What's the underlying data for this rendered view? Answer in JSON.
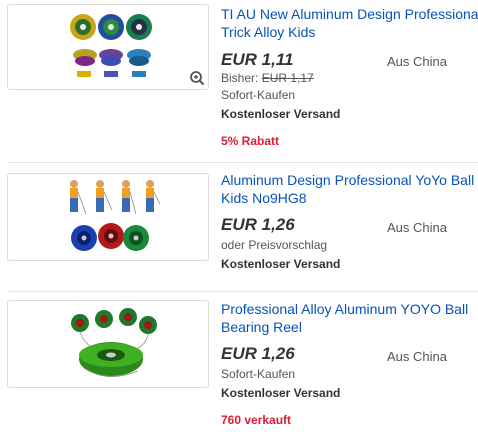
{
  "listings": [
    {
      "title_line1": "TI AU New Aluminum Design Professional",
      "title_line2": "Trick Alloy Kids",
      "price": "EUR 1,11",
      "origin": "Aus China",
      "previous_label": "Bisher: ",
      "previous_price": "EUR 1,17",
      "buy_format": "Sofort-Kaufen",
      "shipping": "Kostenloser Versand",
      "promo": "5% Rabatt",
      "zoom_icon": "zoom-in-icon"
    },
    {
      "title_line1": "Aluminum Design Professional YoYo Ball",
      "title_line2": "Kids No9HG8",
      "price": "EUR 1,26",
      "origin": "Aus China",
      "buy_format": "oder Preisvorschlag",
      "shipping": "Kostenloser Versand"
    },
    {
      "title_line1": "Professional Alloy Aluminum YOYO Ball",
      "title_line2": "Bearing Reel",
      "price": "EUR 1,26",
      "origin": "Aus China",
      "buy_format": "Sofort-Kaufen",
      "shipping": "Kostenloser Versand",
      "promo": "760 verkauft"
    }
  ],
  "colors": {
    "link": "#0654ba",
    "promo": "#dd1e31",
    "price": "#333333"
  }
}
